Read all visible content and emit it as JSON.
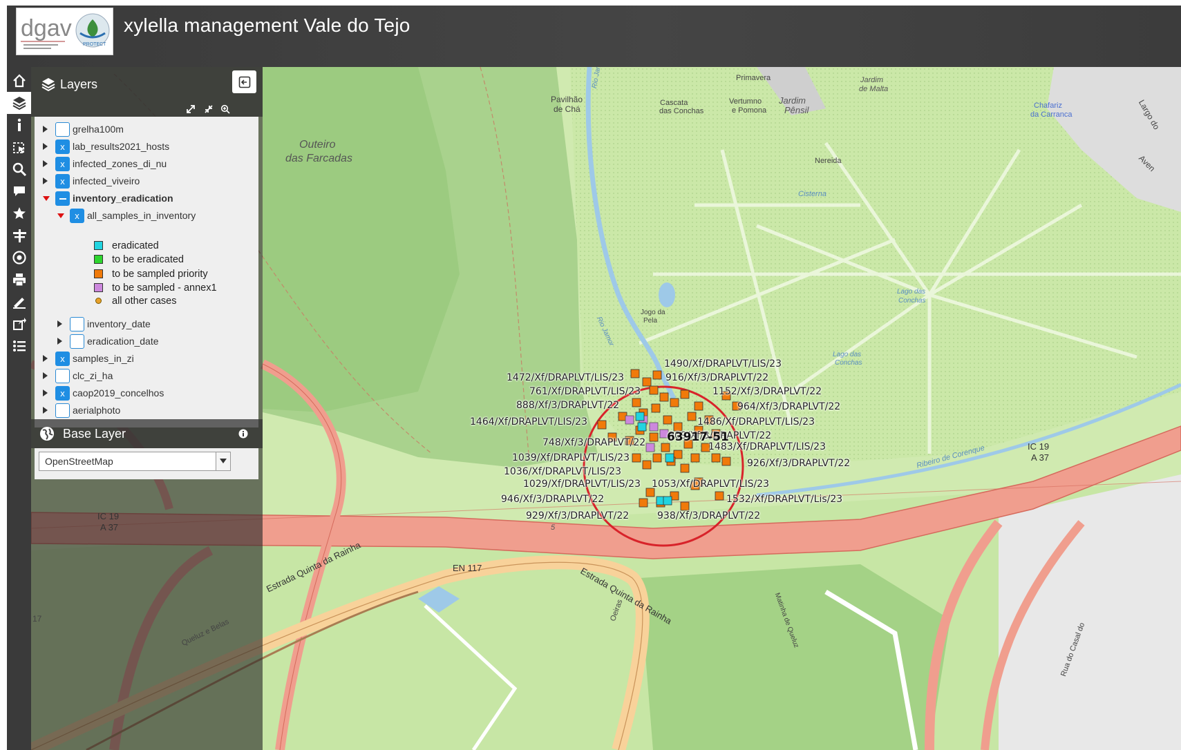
{
  "header": {
    "title": "xylella management Vale do Tejo",
    "logo_dgav": "dgav",
    "logo_plant": "PROTECT"
  },
  "toolbar": {
    "icons": [
      "home-icon",
      "layers-icon",
      "info-icon",
      "select-icon",
      "search-icon",
      "comment-icon",
      "star-icon",
      "road-icon",
      "target-icon",
      "print-icon",
      "measure-icon",
      "share-icon",
      "list-icon"
    ],
    "active": "layers-icon"
  },
  "layers": {
    "title": "Layers",
    "items": [
      {
        "label": "grelha100m",
        "checked": false
      },
      {
        "label": "lab_results2021_hosts",
        "checked": true
      },
      {
        "label": "infected_zones_di_nu",
        "checked": true
      },
      {
        "label": "infected_viveiro",
        "checked": true
      },
      {
        "label": "inventory_eradication",
        "state": "partial",
        "expanded": true
      },
      {
        "label": "all_samples_in_inventory",
        "checked": true,
        "expanded": true
      },
      {
        "label": "inventory_date",
        "checked": false
      },
      {
        "label": "eradication_date",
        "checked": false
      },
      {
        "label": "samples_in_zi",
        "checked": true
      },
      {
        "label": "clc_zi_ha",
        "checked": false
      },
      {
        "label": "caop2019_concelhos",
        "checked": true
      },
      {
        "label": "aerialphoto",
        "checked": false
      }
    ],
    "legend": [
      {
        "label": "eradicated",
        "color": "#21d4e0"
      },
      {
        "label": "to be eradicated",
        "color": "#2ed52e"
      },
      {
        "label": "to be sampled priority",
        "color": "#f07a0a"
      },
      {
        "label": "to be sampled - annex1",
        "color": "#cc88dd"
      },
      {
        "label": "all other cases",
        "color": "#e8a12a"
      }
    ]
  },
  "base_layer": {
    "title": "Base Layer",
    "selected": "OpenStreetMap"
  },
  "map": {
    "place_labels": [
      "Outeiro",
      "das Farcadas",
      "Pavilhão",
      "de Chá",
      "Cascata",
      "das Conchas",
      "Primavera",
      "Vertumno",
      "e Pomona",
      "Jardim",
      "Pênsil",
      "Jardim",
      "de Malta",
      "Chafariz",
      "da Carranca",
      "Nereida",
      "Cisterna",
      "Lago das",
      "Conchas",
      "Lago das",
      "Conchas",
      "Jogo da",
      "Pela",
      "Rio Jamor",
      "Rio Jamor",
      "Ribeiro de Corenque",
      "Estrada Quinta da Rainha",
      "Estrada Quinta da Rainha",
      "EN 117",
      "IC 19",
      "A 37",
      "IC 19",
      "A 37",
      "Queluz e Belas",
      "Oeiras",
      "Matinha de Queluz",
      "Rua do Casal do",
      "Largo do",
      "Aven",
      "17",
      "5"
    ],
    "cluster_label": "63917-51",
    "sample_labels": [
      "1490/Xf/DRAPLVT/LIS/23",
      "1472/Xf/DRAPLVT/LIS/23",
      "916/Xf/3/DRAPLVT/22",
      "761/Xf/DRAPLVT/LIS/23",
      "1152/Xf/3/DRAPLVT/22",
      "888/Xf/3/DRAPLVT/22",
      "964/Xf/3/DRAPLVT/22",
      "1464/Xf/DRAPLVT/LIS/23",
      "1486/Xf/DRAPLVT/LIS/23",
      "909/Xf/3/DRAPLVT/22",
      "748/Xf/3/DRAPLVT/22",
      "1483/Xf/DRAPLVT/LIS/23",
      "1039/Xf/DRAPLVT/LIS/23",
      "926/Xf/3/DRAPLVT/22",
      "1036/Xf/DRAPLVT/LIS/23",
      "1029/Xf/DRAPLVT/LIS/23",
      "1053/Xf/DRAPLVT/LIS/23",
      "946/Xf/3/DRAPLVT/22",
      "1532/Xf/DRAPLVT/Lis/23",
      "929/Xf/3/DRAPLVT/22",
      "938/Xf/3/DRAPLVT/22"
    ]
  }
}
